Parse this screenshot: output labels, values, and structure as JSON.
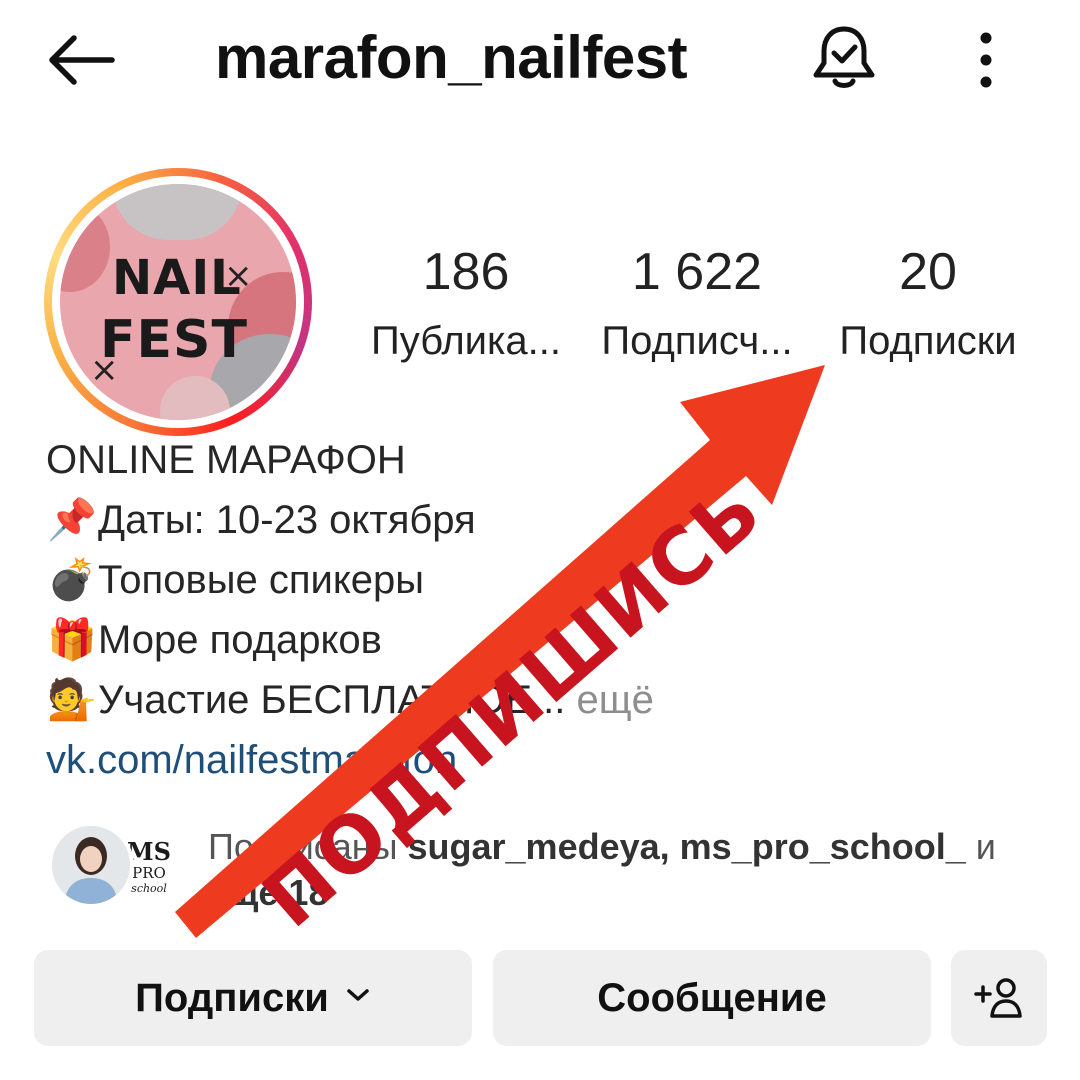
{
  "header": {
    "username": "marafon_nailfest",
    "back_icon": "arrow-left-icon",
    "bell_icon": "bell-check-icon",
    "more_icon": "more-vertical-icon"
  },
  "avatar": {
    "logo_line1": "NAIL",
    "logo_line2": "FEST",
    "logo_mark": "×"
  },
  "stats": [
    {
      "value": "186",
      "label": "Публика..."
    },
    {
      "value": "1 622",
      "label": "Подписч..."
    },
    {
      "value": "20",
      "label": "Подписки"
    }
  ],
  "bio": {
    "title": "ONLINE МАРАФОН",
    "lines": [
      {
        "emoji": "📌",
        "text": "Даты: 10-23 октября"
      },
      {
        "emoji": "💣",
        "text": "Топовые спикеры"
      },
      {
        "emoji": "🎁",
        "text": "Море подарков"
      },
      {
        "emoji": "💁",
        "text": "Участие БЕСПЛАТНОЕ..."
      }
    ],
    "more": " ещё",
    "link": "vk.com/nailfestmarafon"
  },
  "followed_by": {
    "prefix": "Подписаны ",
    "names": "sugar_medeya, ms_pro_school_",
    "suffix": " и ",
    "more": "ещё 18",
    "avatar2_text": "MS PRO school"
  },
  "buttons": {
    "following": "Подписки",
    "message": "Сообщение",
    "add_user_icon": "add-user-icon"
  },
  "overlay": {
    "text": "ПОДПИШИСЬ",
    "arrow_color": "#ee3a1e",
    "text_color": "#c8141e"
  }
}
